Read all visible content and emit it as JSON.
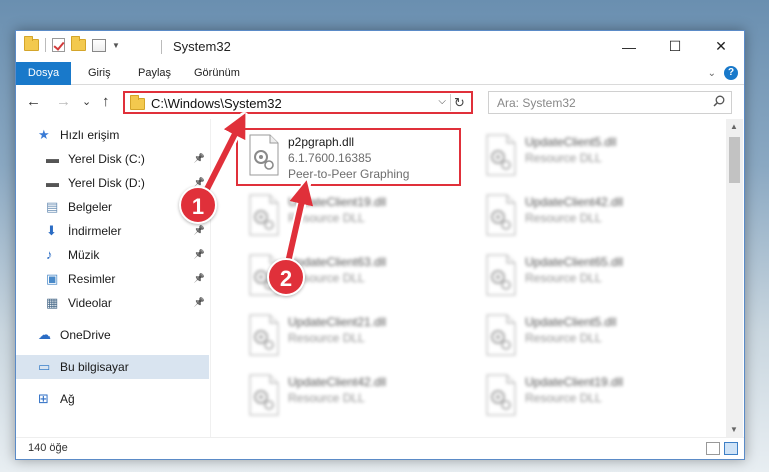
{
  "window": {
    "title": "System32",
    "controls": {
      "minimize": "—",
      "maximize": "☐",
      "close": "✕"
    }
  },
  "ribbon": {
    "tabs": [
      "Dosya",
      "Giriş",
      "Paylaş",
      "Görünüm"
    ],
    "help": "?"
  },
  "address": {
    "path": "C:\\Windows\\System32",
    "refresh": "↻",
    "dropdown": "⌵"
  },
  "search": {
    "placeholder": "Ara: System32"
  },
  "nav": {
    "back": "←",
    "forward": "→",
    "recent": "⌄",
    "up": "↑"
  },
  "sidebar": {
    "items": [
      {
        "label": "Hızlı erişim",
        "icon": "star-icon",
        "pinned": false
      },
      {
        "label": "Yerel Disk (C:)",
        "icon": "drive-icon",
        "pinned": true
      },
      {
        "label": "Yerel Disk (D:)",
        "icon": "drive-icon",
        "pinned": true
      },
      {
        "label": "Belgeler",
        "icon": "documents-icon",
        "pinned": true
      },
      {
        "label": "İndirmeler",
        "icon": "download-icon",
        "pinned": true
      },
      {
        "label": "Müzik",
        "icon": "music-icon",
        "pinned": true
      },
      {
        "label": "Resimler",
        "icon": "pictures-icon",
        "pinned": true
      },
      {
        "label": "Videolar",
        "icon": "videos-icon",
        "pinned": true
      },
      {
        "label": "OneDrive",
        "icon": "cloud-icon",
        "pinned": false
      },
      {
        "label": "Bu bilgisayar",
        "icon": "computer-icon",
        "pinned": false
      },
      {
        "label": "Ağ",
        "icon": "network-icon",
        "pinned": false
      }
    ]
  },
  "files": [
    {
      "name": "p2pgraph.dll",
      "line2": "6.1.7600.16385",
      "line3": "Peer-to-Peer Graphing",
      "blurred": false
    },
    {
      "name": "UpdateClient19.dll",
      "line2": "Resource DLL",
      "blurred": true
    },
    {
      "name": "UpdateClient63.dll",
      "line2": "Resource DLL",
      "blurred": true
    },
    {
      "name": "UpdateClient21.dll",
      "line2": "Resource DLL",
      "blurred": true
    },
    {
      "name": "UpdateClient42.dll",
      "line2": "Resource DLL",
      "blurred": true
    },
    {
      "name": "UpdateClient5.dll",
      "line2": "Resource DLL",
      "blurred": true
    },
    {
      "name": "UpdateClient42.dll",
      "line2": "Resource DLL",
      "blurred": true
    },
    {
      "name": "UpdateClient65.dll",
      "line2": "Resource DLL",
      "blurred": true
    },
    {
      "name": "UpdateClient5.dll",
      "line2": "Resource DLL",
      "blurred": true
    },
    {
      "name": "UpdateClient19.dll",
      "line2": "Resource DLL",
      "blurred": true
    }
  ],
  "status": {
    "count": "140 öğe"
  },
  "annotations": {
    "badge1": "1",
    "badge2": "2",
    "color": "#e0303a"
  }
}
